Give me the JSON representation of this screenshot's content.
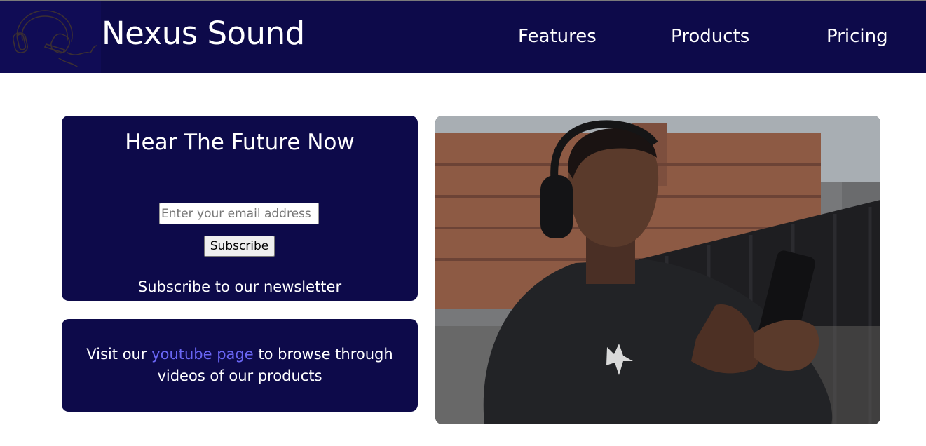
{
  "header": {
    "logo_icon": "headphones-icon",
    "brand": "Nexus Sound",
    "nav": [
      {
        "label": "Features"
      },
      {
        "label": "Products"
      },
      {
        "label": "Pricing"
      }
    ]
  },
  "newsletter": {
    "title": "Hear The Future Now",
    "email_placeholder": "Enter your email address",
    "email_value": "",
    "subscribe_label": "Subscribe",
    "caption": "Subscribe to our newsletter"
  },
  "youtube": {
    "prefix": "Visit our ",
    "link_text": "youtube page",
    "suffix": " to browse through videos of our products"
  },
  "colors": {
    "brand": "#0d0a4a",
    "link": "#6a66f5"
  }
}
